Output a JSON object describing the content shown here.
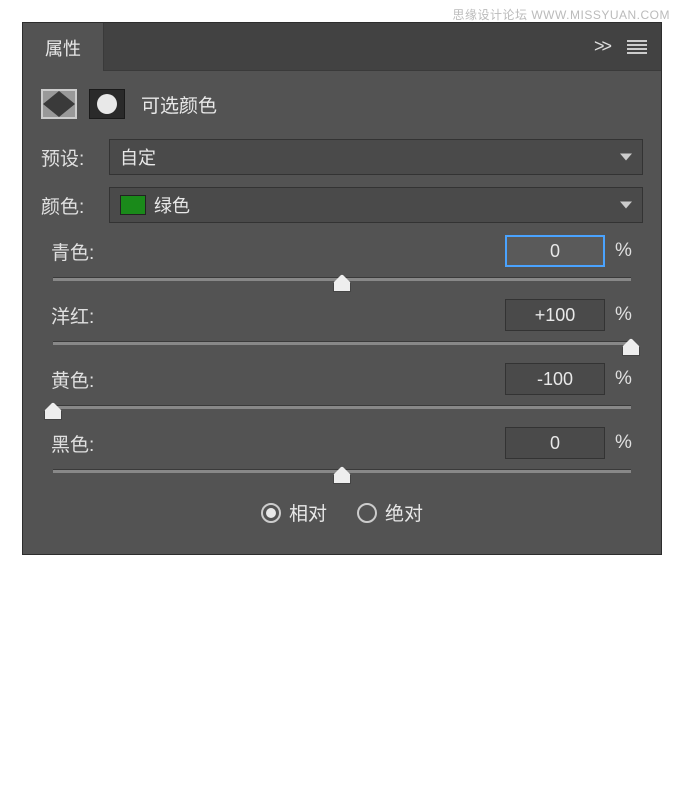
{
  "watermark": "思缘设计论坛 WWW.MISSYUAN.COM",
  "panel": {
    "tab_label": "属性",
    "adjustment_title": "可选颜色"
  },
  "preset": {
    "label": "预设:",
    "value": "自定"
  },
  "colors": {
    "label": "颜色:",
    "value": "绿色",
    "swatch": "#1a8a1a"
  },
  "sliders": {
    "cyan": {
      "label": "青色:",
      "value": "0",
      "percent_pos": 50
    },
    "magenta": {
      "label": "洋红:",
      "value": "+100",
      "percent_pos": 100
    },
    "yellow": {
      "label": "黄色:",
      "value": "-100",
      "percent_pos": 0
    },
    "black": {
      "label": "黑色:",
      "value": "0",
      "percent_pos": 50
    }
  },
  "method": {
    "relative": "相对",
    "absolute": "绝对",
    "selected": "relative"
  },
  "unit": "%"
}
